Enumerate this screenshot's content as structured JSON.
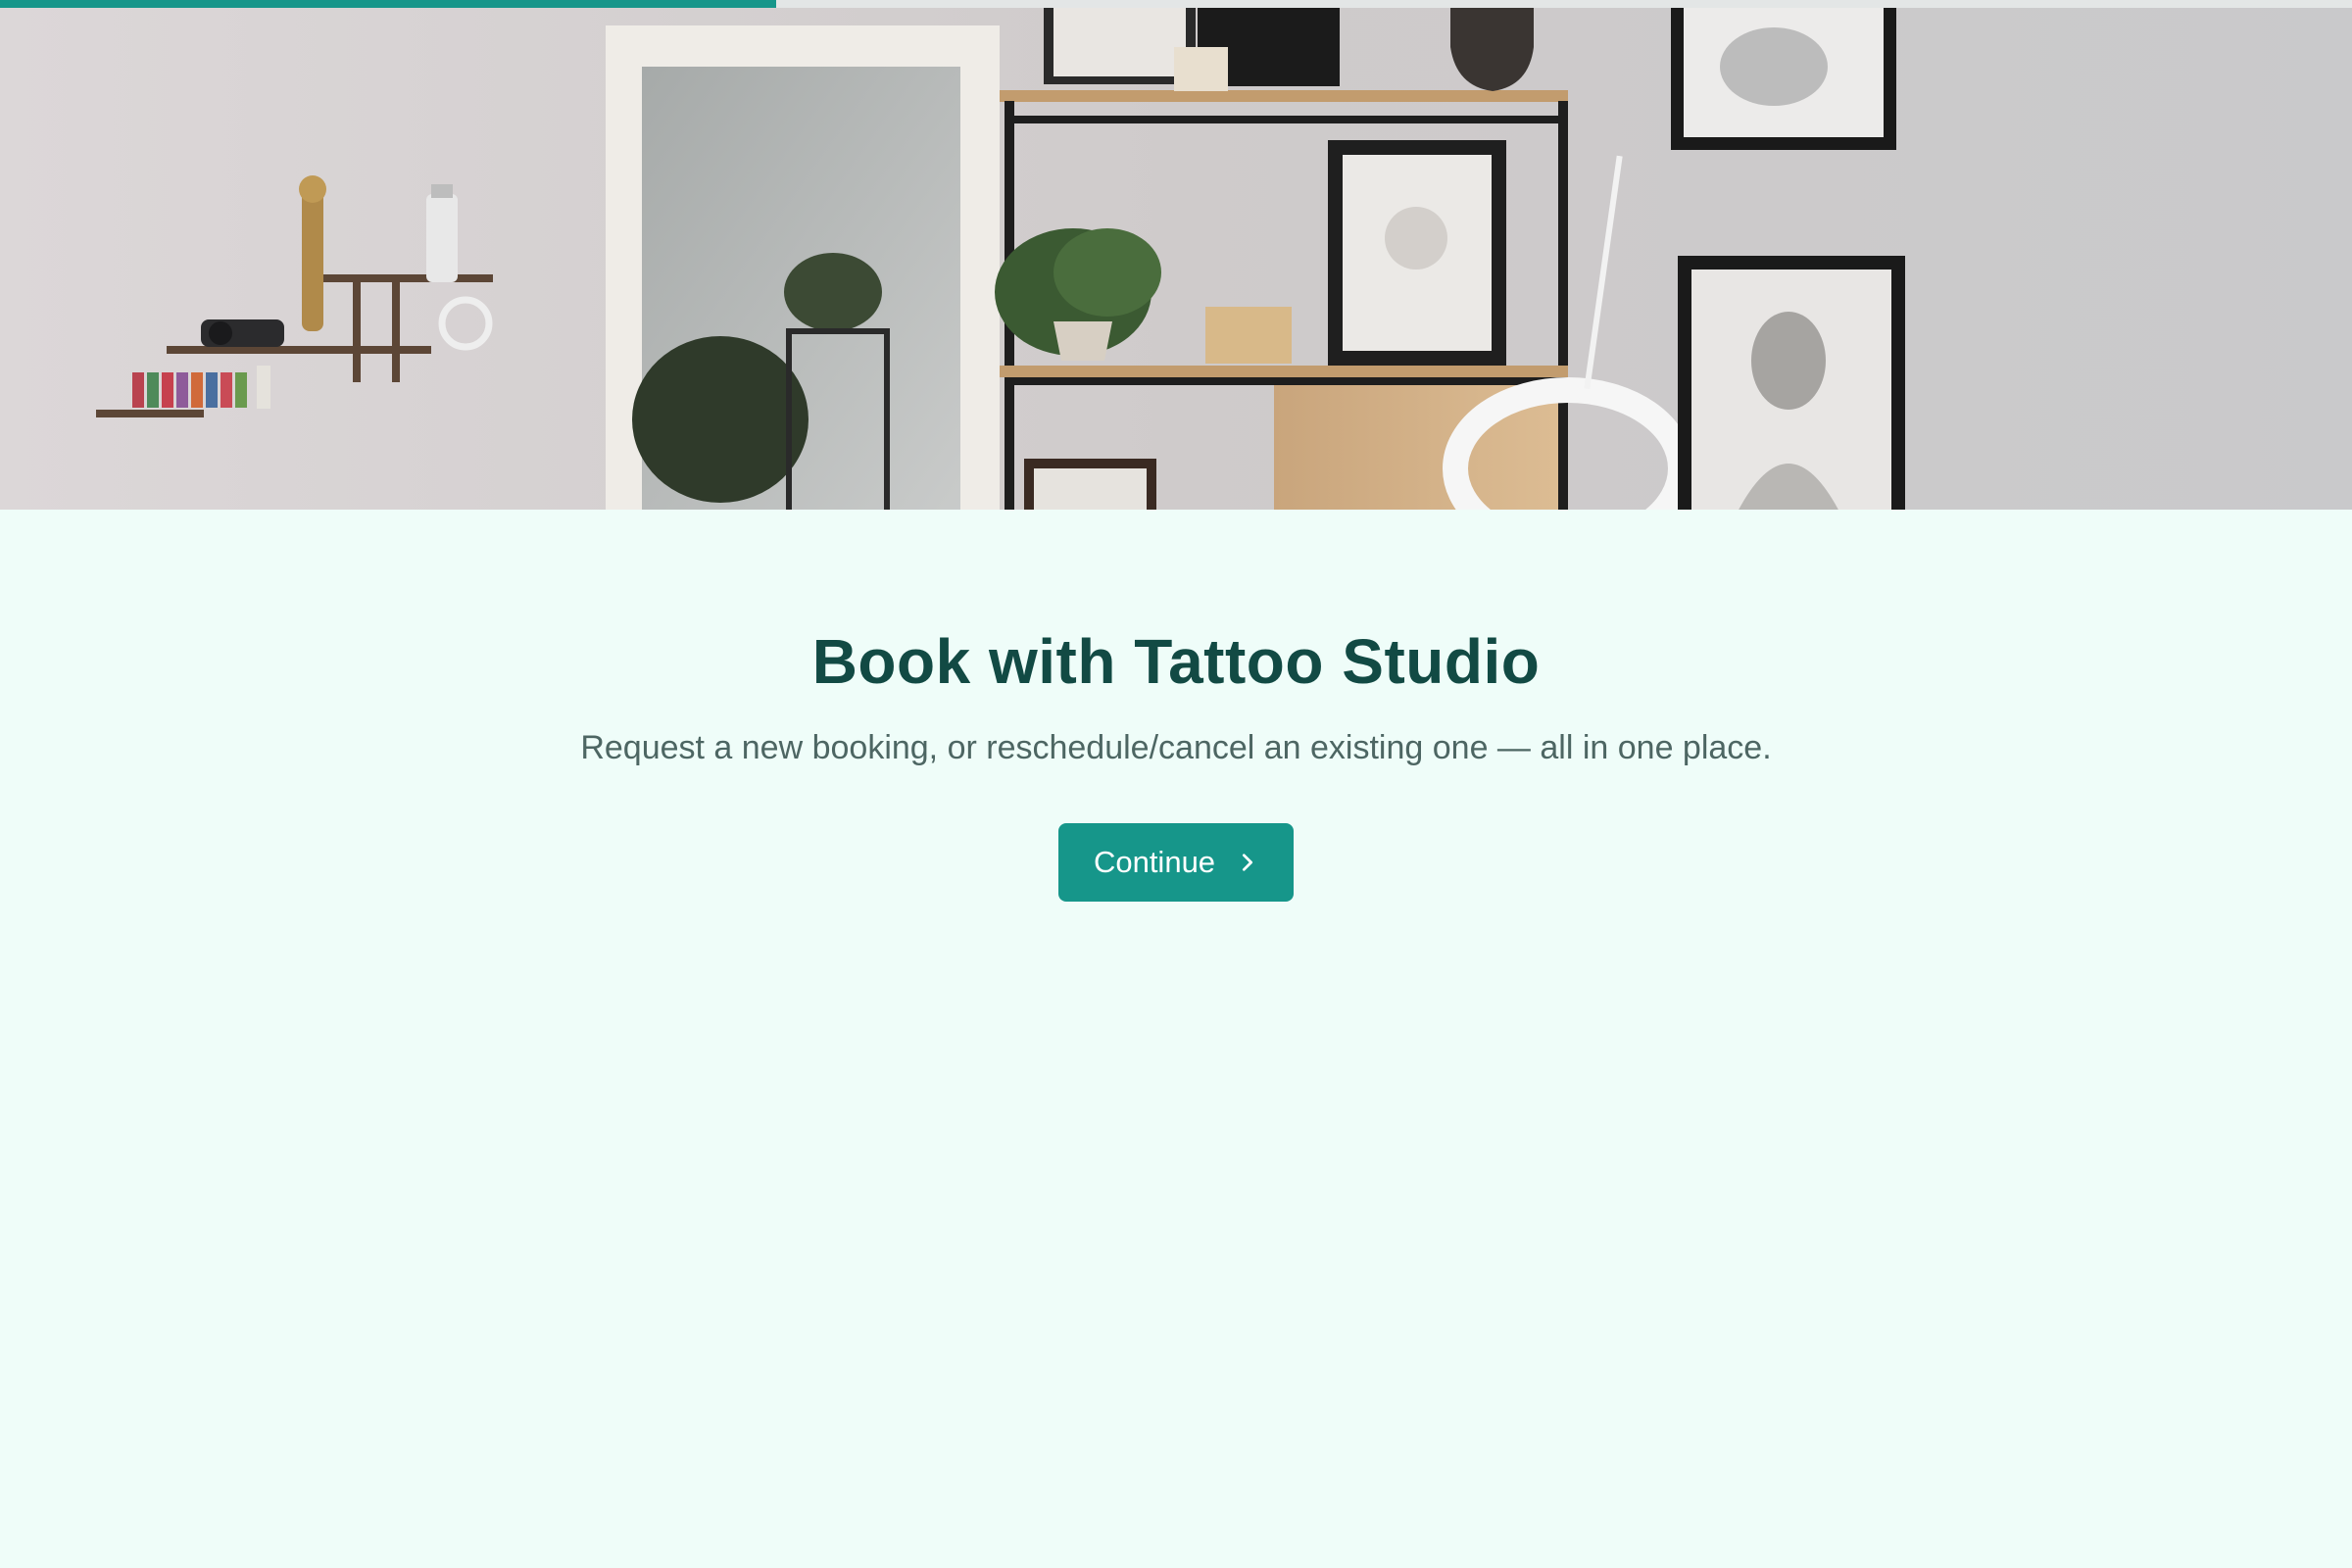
{
  "progress": {
    "fraction": 0.33
  },
  "hero": {
    "image": "tattoo-studio-interior-photo"
  },
  "booking": {
    "title": "Book with Tattoo Studio",
    "subtitle": "Request a new booking, or reschedule/cancel an existing one — all in one place.",
    "continue_label": "Continue",
    "continue_icon": "chevron-right-icon"
  },
  "colors": {
    "accent": "#16968a",
    "title": "#124a44",
    "background": "#effdf9"
  }
}
